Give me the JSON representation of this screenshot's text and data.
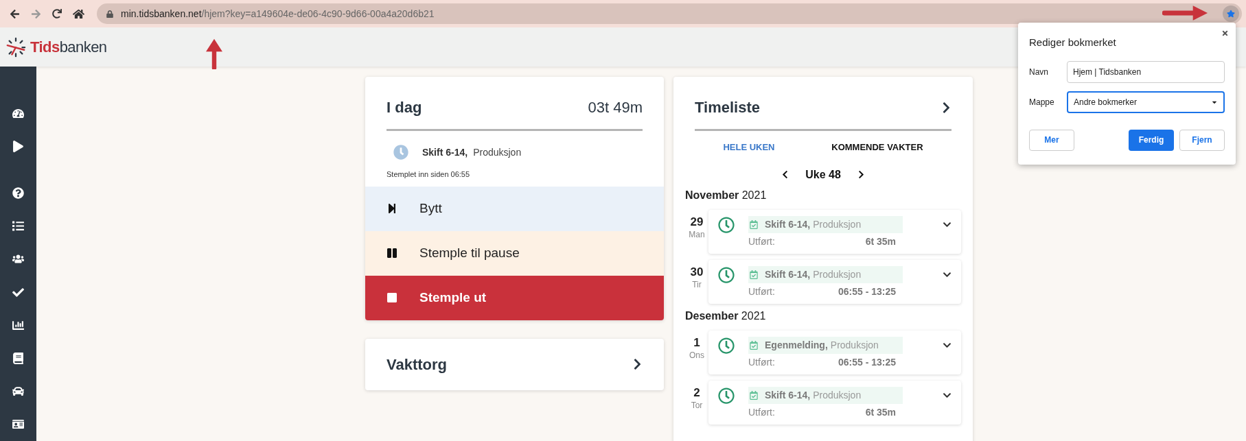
{
  "browser": {
    "host": "min.tidsbanken.net",
    "path": "/hjem?key=a149604e-de06-4c90-9d66-00a4a20d6b21"
  },
  "logo": {
    "first": "Tids",
    "second": "banken"
  },
  "sidebar": {
    "items": [
      {
        "kind": "gauge"
      },
      {
        "kind": "play"
      },
      {
        "kind": "help"
      },
      {
        "kind": "list"
      },
      {
        "kind": "users"
      },
      {
        "kind": "check"
      },
      {
        "kind": "chart"
      },
      {
        "kind": "book"
      },
      {
        "kind": "car"
      },
      {
        "kind": "card"
      }
    ]
  },
  "today": {
    "title": "I dag",
    "total": "03t 49m",
    "shift": "Skift 6-14,",
    "department": "Produksjon",
    "status": "Stemplet inn siden 06:55",
    "actions": [
      {
        "kind": "switch",
        "label": "Bytt"
      },
      {
        "kind": "pause",
        "label": "Stemple til pause"
      },
      {
        "kind": "stop",
        "label": "Stemple ut"
      }
    ]
  },
  "market": {
    "title": "Vakttorg"
  },
  "timesheet": {
    "title": "Timeliste",
    "tabs": [
      {
        "label": "HELE UKEN",
        "selected": true
      },
      {
        "label": "KOMMENDE VAKTER",
        "selected": false
      }
    ],
    "week": "Uke 48",
    "months": [
      {
        "month": "November",
        "year": "2021",
        "days": [
          {
            "day": "29",
            "weekday": "Man",
            "shift": "Skift 6-14,",
            "department": "Produksjon",
            "done_label": "Utført:",
            "done_value": "6t 35m"
          },
          {
            "day": "30",
            "weekday": "Tir",
            "shift": "Skift 6-14,",
            "department": "Produksjon",
            "done_label": "Utført:",
            "done_value": "06:55 - 13:25"
          }
        ]
      },
      {
        "month": "Desember",
        "year": "2021",
        "days": [
          {
            "day": "1",
            "weekday": "Ons",
            "shift": "Egenmelding,",
            "department": "Produksjon",
            "done_label": "Utført:",
            "done_value": "06:55 - 13:25"
          },
          {
            "day": "2",
            "weekday": "Tor",
            "shift": "Skift 6-14,",
            "department": "Produksjon",
            "done_label": "Utført:",
            "done_value": "6t 35m"
          }
        ]
      }
    ]
  },
  "bookmark_popup": {
    "title": "Rediger bokmerket",
    "fields": [
      {
        "kind": "text",
        "label": "Navn",
        "value": "Hjem | Tidsbanken",
        "focused": false
      },
      {
        "kind": "select",
        "label": "Mappe",
        "value": "Andre bokmerker",
        "focused": true
      }
    ],
    "buttons": [
      {
        "kind": "secondary",
        "label": "Mer"
      },
      {
        "kind": "primary",
        "label": "Ferdig"
      },
      {
        "kind": "secondary",
        "label": "Fjern"
      }
    ]
  }
}
